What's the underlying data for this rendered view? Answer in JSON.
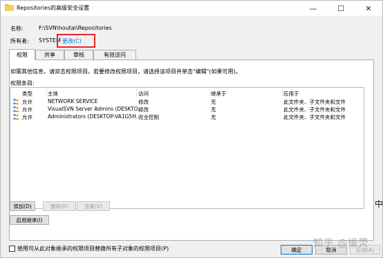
{
  "window": {
    "title": "Repositories的高级安全设置",
    "minimize_glyph": "—",
    "maximize_glyph": "☐",
    "close_glyph": "✕"
  },
  "info": {
    "name_label": "名称:",
    "name_value": "F:\\SVN\\houtai\\Repositories",
    "owner_label": "所有者:",
    "owner_value": "SYSTEM",
    "change_link": "更改(C)"
  },
  "tabs": [
    {
      "label": "权限",
      "active": true
    },
    {
      "label": "共享",
      "active": false
    },
    {
      "label": "审核",
      "active": false
    },
    {
      "label": "有效访问",
      "active": false
    }
  ],
  "instructions": "如需其他信息，请双击权限项目。若要修改权限项目，请选择该项目并单击\"编辑\"(如果可用)。",
  "entries_label": "权限条目:",
  "table": {
    "columns": [
      "类型",
      "主体",
      "访问",
      "继承于",
      "应用于"
    ],
    "rows": [
      {
        "type": "允许",
        "principal": "NETWORK SERVICE",
        "access": "修改",
        "inherited": "无",
        "applies": "此文件夹、子文件夹和文件"
      },
      {
        "type": "允许",
        "principal": "VisualSVN Server Admins (DESKTO...",
        "access": "修改",
        "inherited": "无",
        "applies": "此文件夹、子文件夹和文件"
      },
      {
        "type": "允许",
        "principal": "Administrators (DESKTOP-VA1G5H...",
        "access": "完全控制",
        "inherited": "无",
        "applies": "此文件夹、子文件夹和文件"
      }
    ]
  },
  "buttons": {
    "add": "添加(D)",
    "remove": "删除(R)",
    "view": "查看(V)",
    "enable_inheritance": "启用继承(I)",
    "ok": "确定",
    "cancel": "取消",
    "apply": "应用(A)"
  },
  "checkbox_label": "使用可从此对象继承的权限项目替换所有子对象的权限项目(P)",
  "side_char": "中",
  "watermark": "知乎 @媛荧",
  "colors": {
    "link": "#0b6fd1",
    "highlight": "#e8262a",
    "primary_border": "#0078d7"
  }
}
